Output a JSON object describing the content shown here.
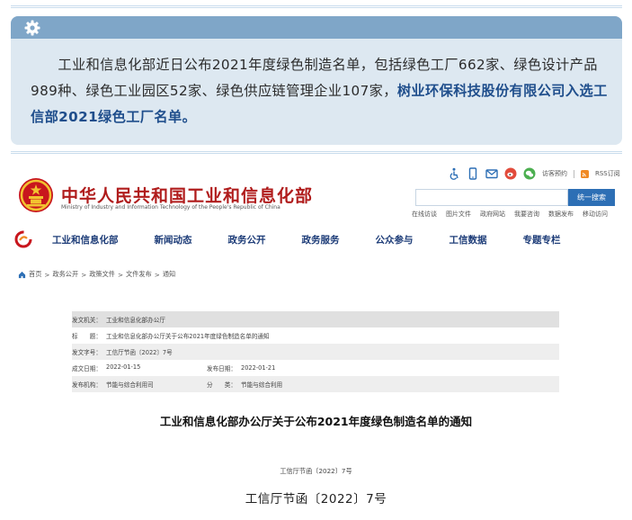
{
  "announcement": {
    "text_plain": "工业和信息化部近日公布2021年度绿色制造名单，包括绿色工厂662家、绿色设计产品989种、绿色工业园区52家、绿色供应链管理企业107家，",
    "text_highlight": "树业环保科技股份有限公司入选工信部2021绿色工厂名单。"
  },
  "site": {
    "title": "中华人民共和国工业和信息化部",
    "subtitle": "Ministry of Industry and Information Technology of the People's Republic of China",
    "util_links": [
      "访客预约",
      "RSS订阅"
    ],
    "search_placeholder": "",
    "search_button": "统一搜索",
    "quick_links": [
      "在线访谈",
      "图片文件",
      "政府网站",
      "我要咨询",
      "数据发布",
      "移动访问"
    ]
  },
  "nav": {
    "items": [
      "工业和信息化部",
      "新闻动态",
      "政务公开",
      "政务服务",
      "公众参与",
      "工信数据",
      "专题专栏"
    ]
  },
  "breadcrumb": [
    "首页",
    "政务公开",
    "政策文件",
    "文件发布",
    "通知"
  ],
  "meta": {
    "issuer_label": "发文机关：",
    "issuer": "工业和信息化部办公厅",
    "subject_label": "标　　题：",
    "subject": "工业和信息化部办公厅关于公布2021年度绿色制造名单的通知",
    "doc_no_label": "发文字号：",
    "doc_no": "工信厅节函〔2022〕7号",
    "written_label": "成文日期：",
    "written": "2022-01-15",
    "published_label": "发布日期：",
    "published": "2022-01-21",
    "org_label": "发布机构：",
    "org": "节能与综合利用司",
    "category_label": "分　　类：",
    "category": "节能与综合利用"
  },
  "article": {
    "title": "工业和信息化部办公厅关于公布2021年度绿色制造名单的通知",
    "doc_number": "工信厅节函〔2022〕7号"
  },
  "caption": "工信厅节函〔2022〕7号",
  "colors": {
    "card_bg": "#dde8f1",
    "card_header": "#7fa6c8",
    "highlight": "#1f4e8c",
    "site_title": "#b01c1c",
    "nav_text": "#1d3c78",
    "search_button": "#2d6fb5"
  }
}
